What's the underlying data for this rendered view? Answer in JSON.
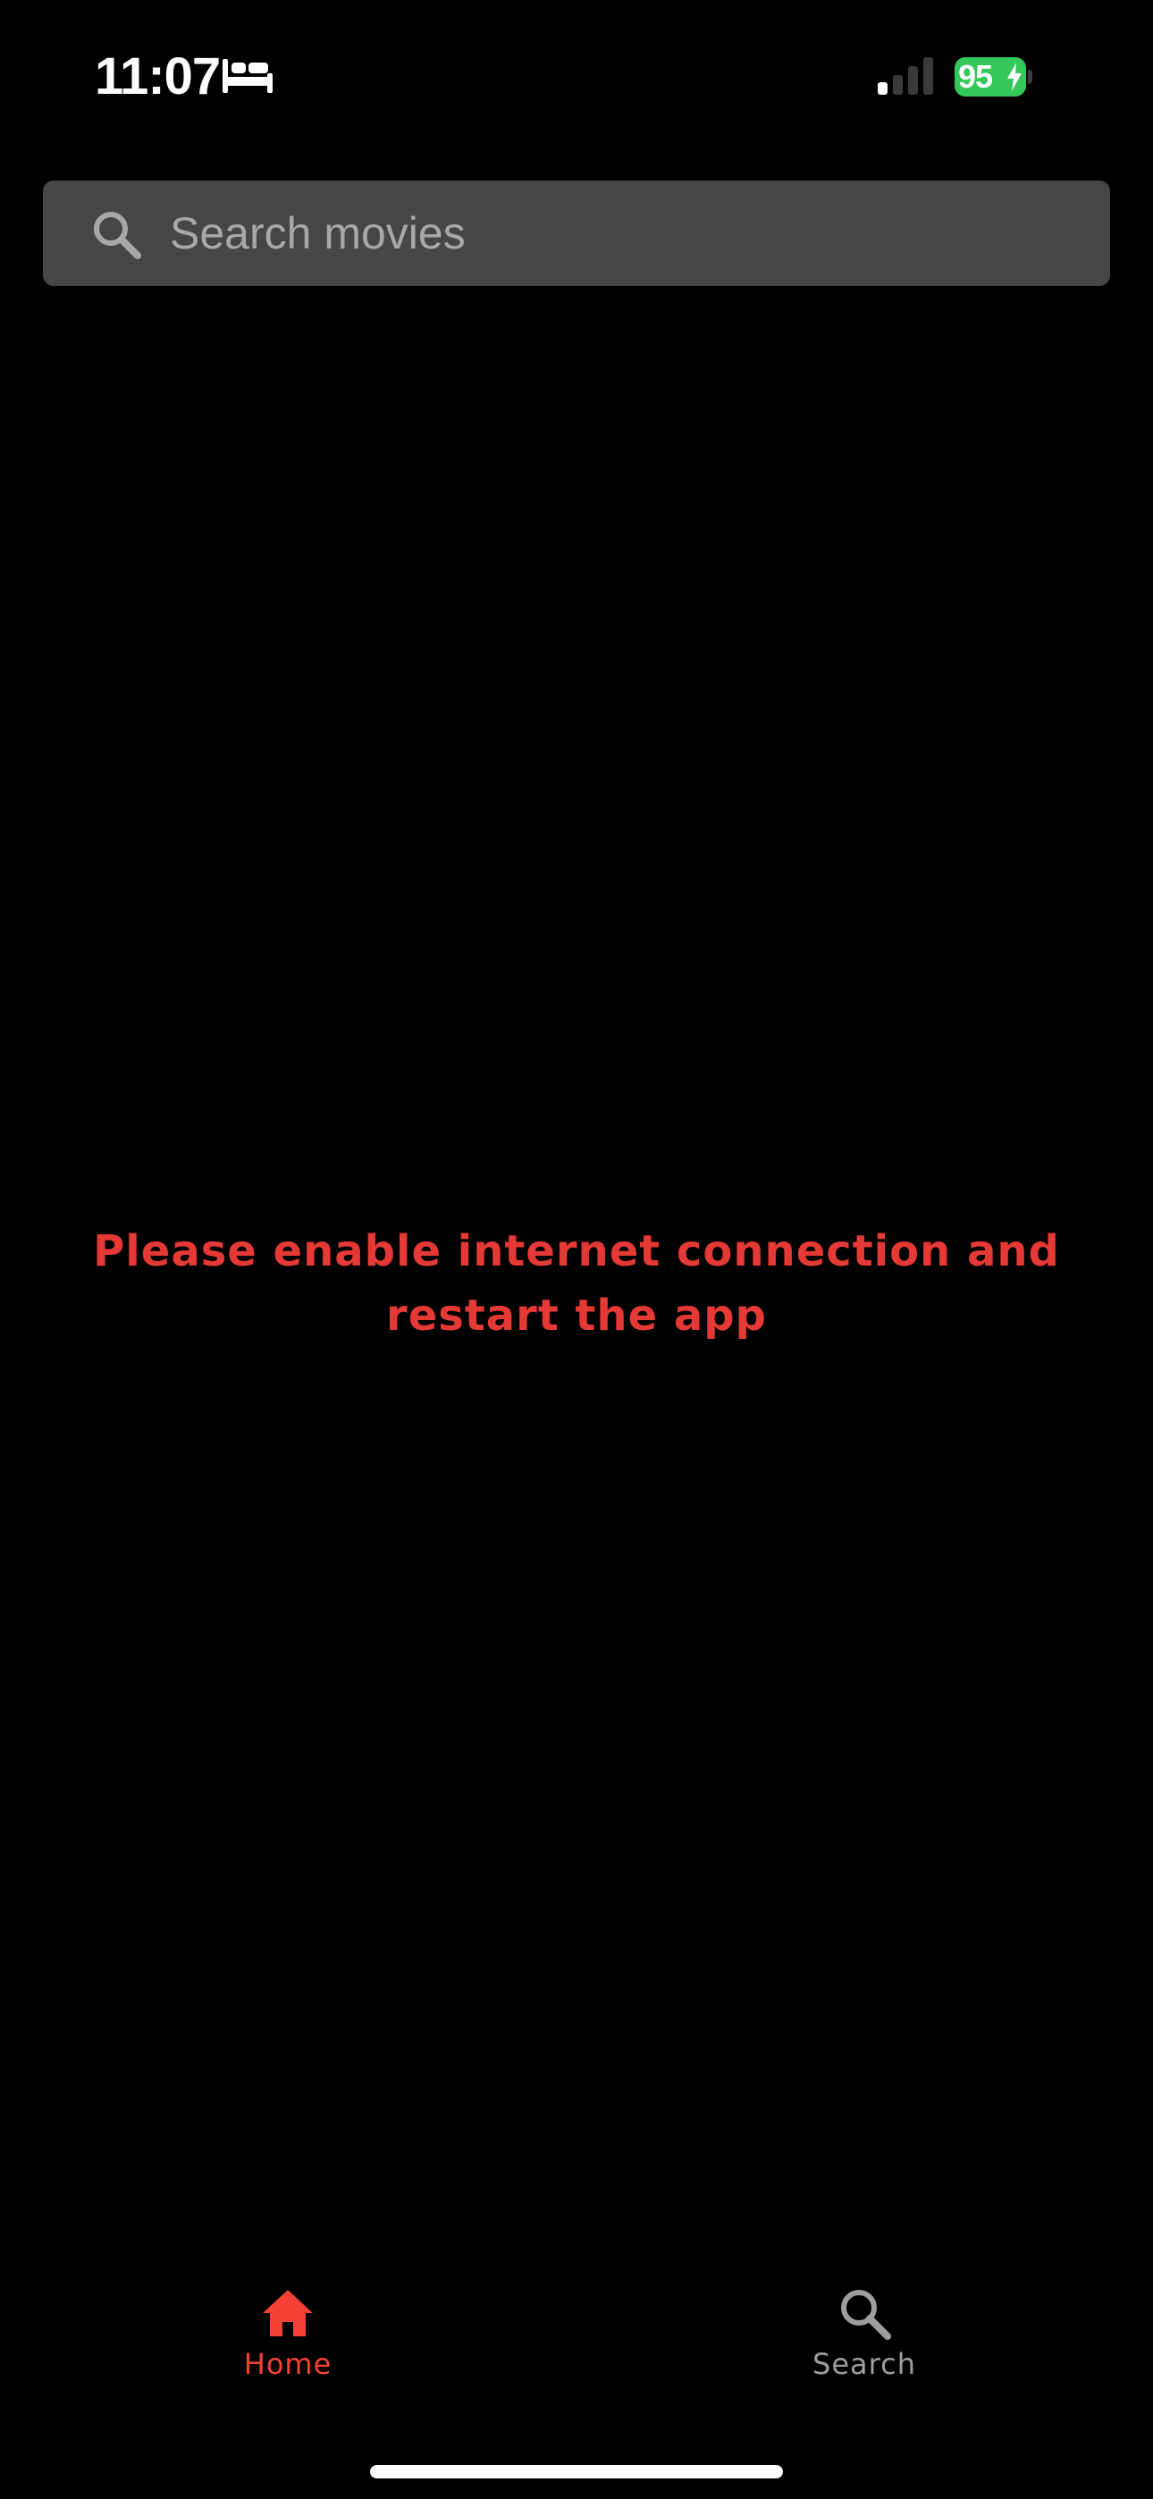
{
  "status_bar": {
    "time": "11:07",
    "battery_level": "95",
    "battery_color": "#34c759",
    "signal_bars_active": 1,
    "signal_bars_total": 4,
    "focus_icon": "bed-icon"
  },
  "search": {
    "placeholder": "Search movies",
    "value": "",
    "icon": "search-icon"
  },
  "message": {
    "text": "Please enable internet connection and restart the app",
    "color": "#e53935"
  },
  "tab_bar": {
    "tabs": [
      {
        "label": "Home",
        "icon": "home-icon",
        "active": true,
        "color": "#f44336"
      },
      {
        "label": "Search",
        "icon": "search-icon",
        "active": false,
        "color": "#9e9e9e"
      }
    ]
  }
}
